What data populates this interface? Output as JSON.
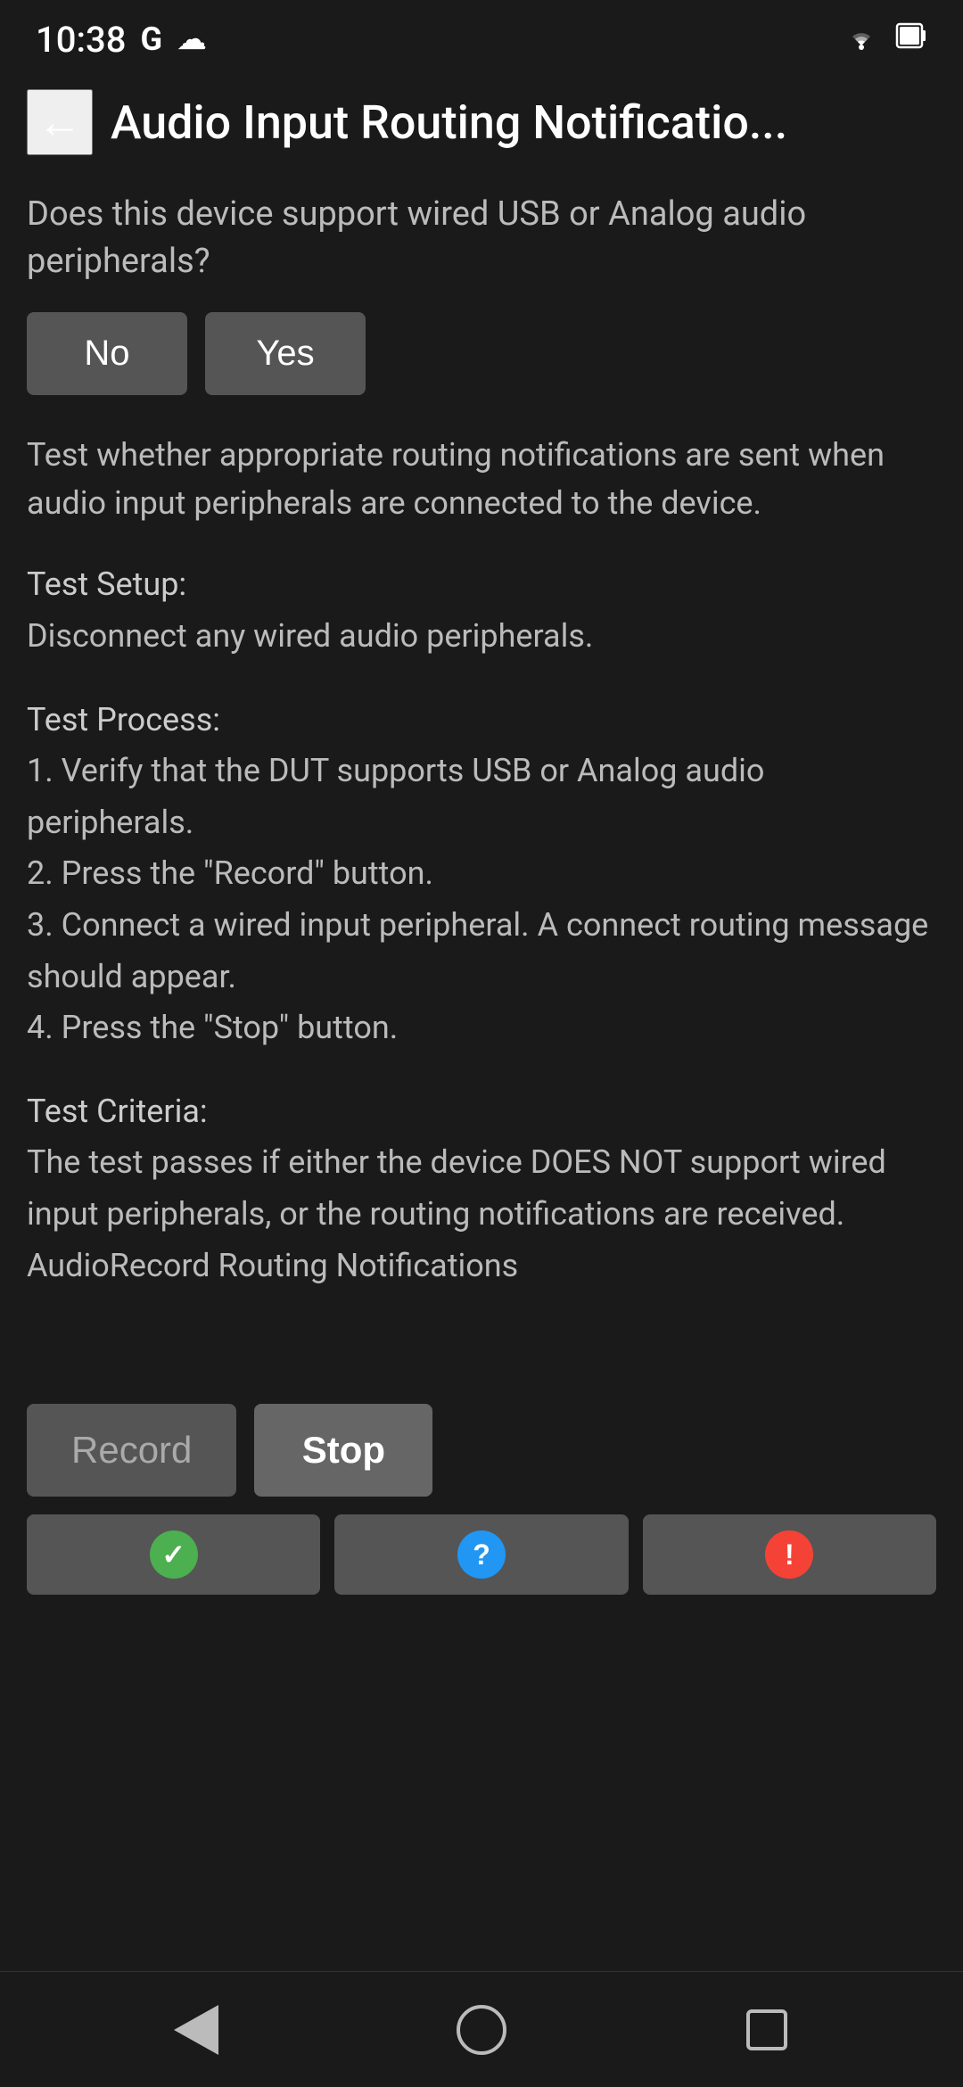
{
  "statusBar": {
    "time": "10:38",
    "gIcon": "G",
    "cloudIcon": "☁",
    "wifiIcon": "wifi",
    "batteryIcon": "battery"
  },
  "header": {
    "backLabel": "←",
    "title": "Audio Input Routing Notificatio..."
  },
  "content": {
    "questionText": "Does this device support wired USB or Analog audio peripherals?",
    "noButtonLabel": "No",
    "yesButtonLabel": "Yes",
    "descriptionText": "Test whether appropriate routing notifications are sent when audio input peripherals are connected to the device.",
    "testSetupLabel": "Test Setup:",
    "testSetupText": "Disconnect any wired audio peripherals.",
    "testProcessLabel": "Test Process:",
    "testProcessText": "1. Verify that the DUT supports USB or Analog audio peripherals.\n2. Press the \"Record\" button.\n3. Connect a wired input peripheral. A connect routing message should appear.\n4. Press the \"Stop\" button.",
    "testCriteriaLabel": "Test Criteria:",
    "testCriteriaText": "The test passes if either the device DOES NOT support wired input peripherals, or the routing notifications are received.\nAudioRecord Routing Notifications"
  },
  "actions": {
    "recordLabel": "Record",
    "stopLabel": "Stop"
  },
  "statusIcons": {
    "passIcon": "✓",
    "helpIcon": "?",
    "errorIcon": "!"
  },
  "navBar": {
    "backLabel": "back",
    "homeLabel": "home",
    "recentsLabel": "recents"
  }
}
